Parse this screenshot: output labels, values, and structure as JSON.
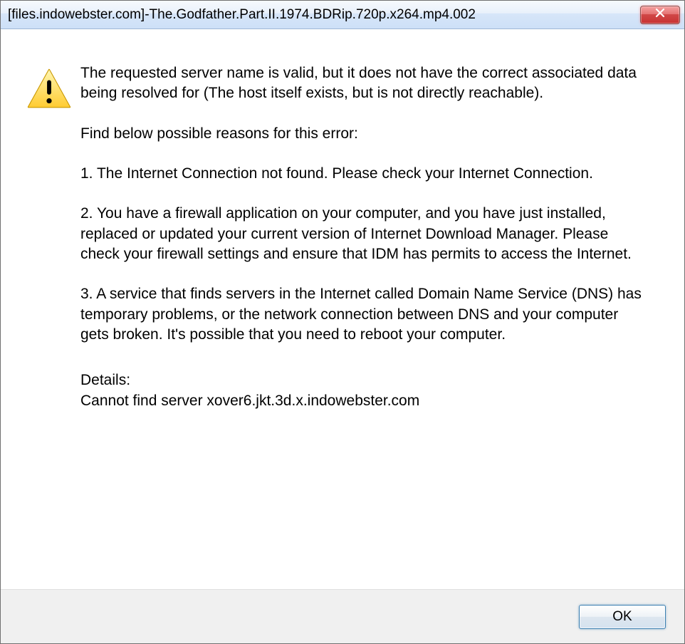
{
  "titlebar": {
    "title": "[files.indowebster.com]-The.Godfather.Part.II.1974.BDRip.720p.x264.mp4.002"
  },
  "message": {
    "intro": "The requested server name is valid, but it does not have the correct associated data being resolved for (The host itself exists, but is not directly reachable).",
    "reasons_header": "Find below possible reasons for this error:",
    "reason1": "1. The Internet Connection not found. Please check your Internet Connection.",
    "reason2": "2. You have a firewall application on your computer, and you have just installed, replaced or updated your current version of Internet Download Manager. Please check your firewall settings and ensure that IDM has permits to access the Internet.",
    "reason3": "3. A service that finds servers in the Internet called Domain Name Service (DNS) has temporary problems, or the network connection between DNS and your computer gets broken. It's possible that you need to reboot your computer.",
    "details_label": "Details:",
    "details_text": "Cannot find server xover6.jkt.3d.x.indowebster.com"
  },
  "buttons": {
    "ok": "OK"
  }
}
